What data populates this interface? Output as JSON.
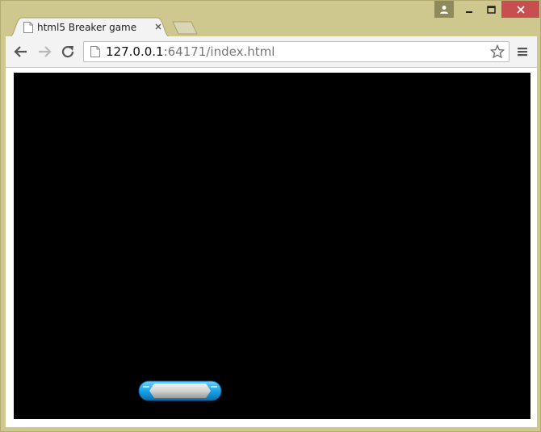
{
  "window": {
    "controls": {
      "profile": "person-icon",
      "minimize": "minimize-icon",
      "maximize": "maximize-icon",
      "close": "close-icon"
    }
  },
  "tabs": [
    {
      "title": "html5 Breaker game",
      "icon": "page-icon",
      "active": true
    }
  ],
  "toolbar": {
    "url_host": "127.0.0.1",
    "url_rest": ":64171/index.html",
    "back_icon": "back-arrow-icon",
    "forward_icon": "forward-arrow-icon",
    "reload_icon": "reload-icon",
    "star_icon": "star-icon",
    "menu_icon": "hamburger-menu-icon"
  },
  "game": {
    "background": "#000000",
    "paddle_colors": {
      "body": "#d3d3d3",
      "caps": "#1aa3e8"
    }
  }
}
